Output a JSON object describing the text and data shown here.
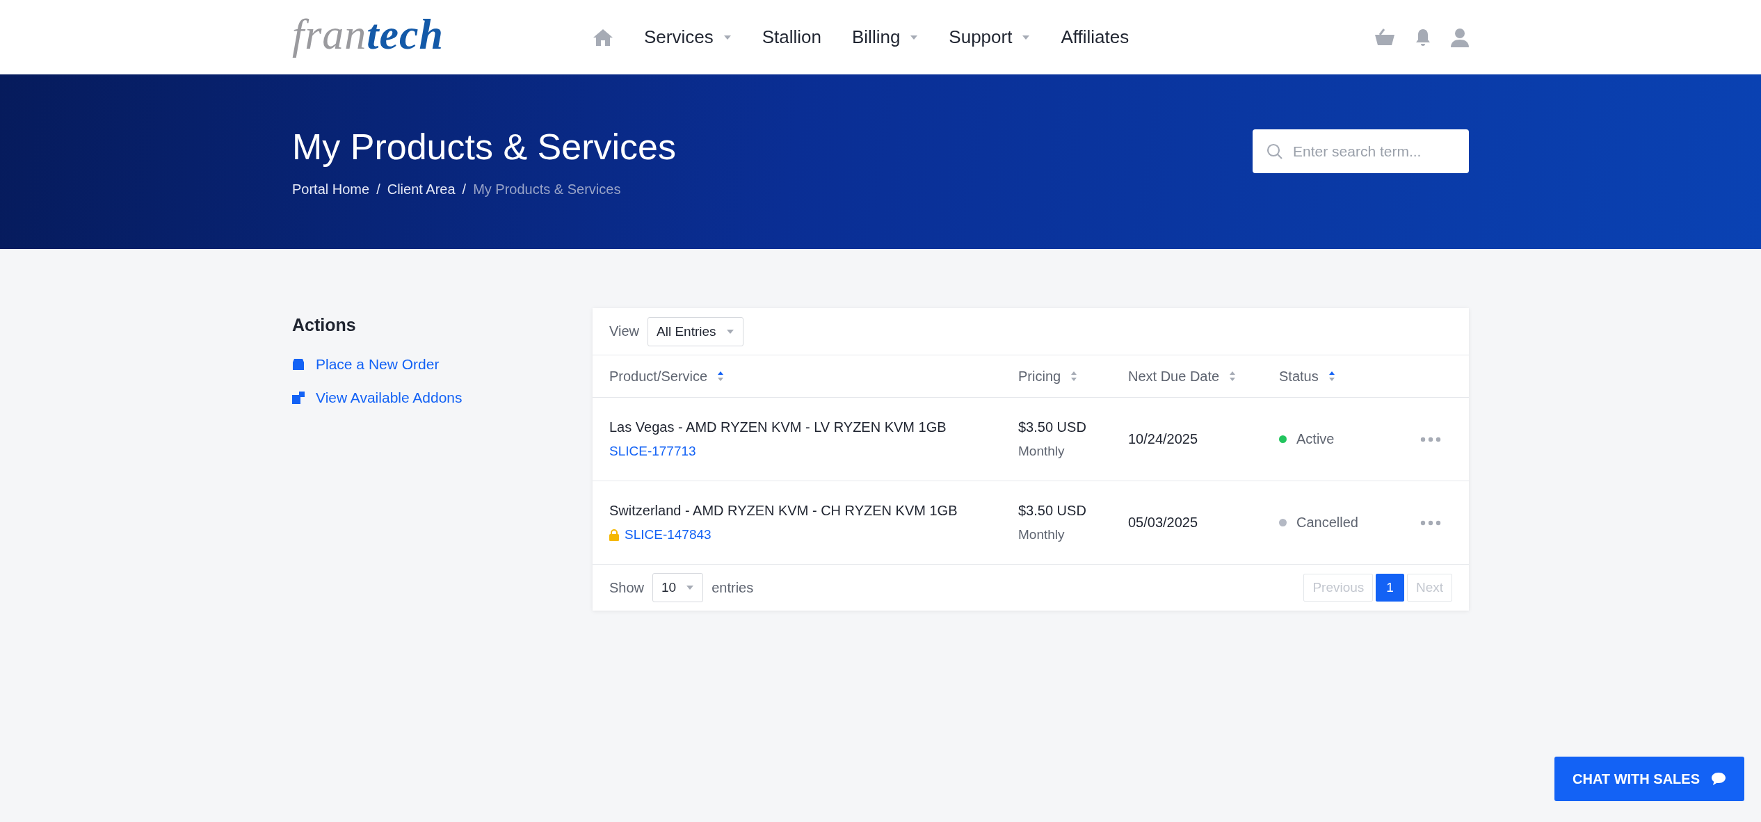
{
  "logo": [
    "fran",
    "tech"
  ],
  "nav": [
    {
      "label": "Services",
      "dropdown": true
    },
    {
      "label": "Stallion",
      "dropdown": false
    },
    {
      "label": "Billing",
      "dropdown": true
    },
    {
      "label": "Support",
      "dropdown": true
    },
    {
      "label": "Affiliates",
      "dropdown": false
    }
  ],
  "hero": {
    "title": "My Products & Services",
    "separator": "/",
    "breadcrumbs": [
      {
        "label": "Portal Home",
        "current": false
      },
      {
        "label": "Client Area",
        "current": false
      },
      {
        "label": "My Products & Services",
        "current": true
      }
    ],
    "search": {
      "placeholder": "Enter search term..."
    }
  },
  "sidebar": {
    "title": "Actions",
    "items": [
      {
        "label": "Place a New Order",
        "kind": "order"
      },
      {
        "label": "View Available Addons",
        "kind": "addons"
      }
    ]
  },
  "table": {
    "view_label": "View",
    "view_value": "All Entries",
    "columns": [
      {
        "label": "Product/Service",
        "sorted": true
      },
      {
        "label": "Pricing",
        "sorted": false
      },
      {
        "label": "Next Due Date",
        "sorted": false
      },
      {
        "label": "Status",
        "sorted": true
      }
    ],
    "rows": [
      {
        "product": "Las Vegas - AMD RYZEN KVM - LV RYZEN KVM 1GB",
        "id": "SLICE-177713",
        "locked": false,
        "price": "$3.50 USD",
        "cycle": "Monthly",
        "due": "10/24/2025",
        "status": "Active",
        "color": "#22c55e"
      },
      {
        "product": "Switzerland - AMD RYZEN KVM - CH RYZEN KVM 1GB",
        "id": "SLICE-147843",
        "locked": true,
        "price": "$3.50 USD",
        "cycle": "Monthly",
        "due": "05/03/2025",
        "status": "Cancelled",
        "color": "#b4b9c4"
      }
    ],
    "show_label": "Show",
    "page_size": "10",
    "entries_label": "entries",
    "pagination": {
      "previous": {
        "label": "Previous",
        "disabled": true
      },
      "pages": [
        {
          "label": "1",
          "selected": true
        }
      ],
      "next": {
        "label": "Next",
        "disabled": true
      }
    }
  },
  "chat_button": "CHAT WITH SALES"
}
